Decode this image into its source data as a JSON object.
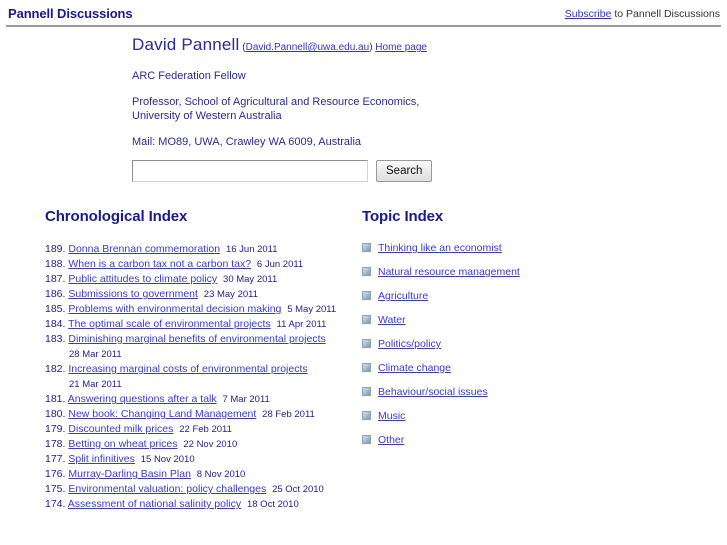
{
  "header": {
    "site_title": "Pannell Discussions",
    "subscribe_link": "Subscribe",
    "subscribe_suffix": " to Pannell Discussions"
  },
  "author": {
    "name": "David Pannell",
    "email_open": " (",
    "email": "David.Pannell@uwa.edu.au",
    "email_close": ") ",
    "home_page": "Home page",
    "lines": [
      "ARC Federation Fellow",
      "Professor, School of Agricultural and Resource Economics,\nUniversity of Western Australia",
      "Mail: MO89, UWA, Crawley WA 6009, Australia"
    ]
  },
  "search": {
    "value": "",
    "placeholder": "",
    "button_label": "Search"
  },
  "chronological": {
    "heading": "Chronological Index",
    "entries": [
      {
        "num": "189.",
        "title": "Donna Brennan commemoration",
        "date": "16 Jun 2011"
      },
      {
        "num": "188.",
        "title": "When is a carbon tax not a carbon tax?",
        "date": "6 Jun 2011"
      },
      {
        "num": "187.",
        "title": "Public attitudes to climate policy",
        "date": "30 May 2011"
      },
      {
        "num": "186.",
        "title": "Submissions to government",
        "date": "23 May 2011"
      },
      {
        "num": "185.",
        "title": "Problems with environmental decision making",
        "date": "5 May 2011"
      },
      {
        "num": "184.",
        "title": "The optimal scale of environmental projects",
        "date": "11 Apr 2011"
      },
      {
        "num": "183.",
        "title": "Diminishing marginal benefits of environmental projects",
        "date": "28 Mar 2011"
      },
      {
        "num": "182.",
        "title": "Increasing marginal costs of environmental projects",
        "date": "21 Mar 2011"
      },
      {
        "num": "181.",
        "title": "Answering questions after a talk",
        "date": "7 Mar 2011"
      },
      {
        "num": "180.",
        "title": "New book: Changing Land Management",
        "date": "28 Feb 2011"
      },
      {
        "num": "179.",
        "title": "Discounted milk prices",
        "date": "22 Feb 2011"
      },
      {
        "num": "178.",
        "title": "Betting on wheat prices",
        "date": "22 Nov 2010"
      },
      {
        "num": "177.",
        "title": "Split infinitives",
        "date": "15 Nov 2010"
      },
      {
        "num": "176.",
        "title": "Murray-Darling Basin Plan",
        "date": "8 Nov 2010"
      },
      {
        "num": "175.",
        "title": "Environmental valuation: policy challenges",
        "date": "25 Oct 2010"
      },
      {
        "num": "174.",
        "title": "Assessment of national salinity policy",
        "date": "18 Oct 2010"
      }
    ]
  },
  "topics": {
    "heading": "Topic Index",
    "bullet_icon": "square-bullet-icon",
    "items": [
      {
        "label": "Thinking like an economist"
      },
      {
        "label": "Natural resource management"
      },
      {
        "label": "Agriculture"
      },
      {
        "label": "Water"
      },
      {
        "label": "Politics/policy"
      },
      {
        "label": "Climate change"
      },
      {
        "label": "Behaviour/social issues"
      },
      {
        "label": "Music"
      },
      {
        "label": "Other"
      }
    ]
  },
  "colors": {
    "title_blue": "#1a1a8c",
    "link_blue": "#3a3ad0",
    "text_blue": "#2b2b8f"
  }
}
